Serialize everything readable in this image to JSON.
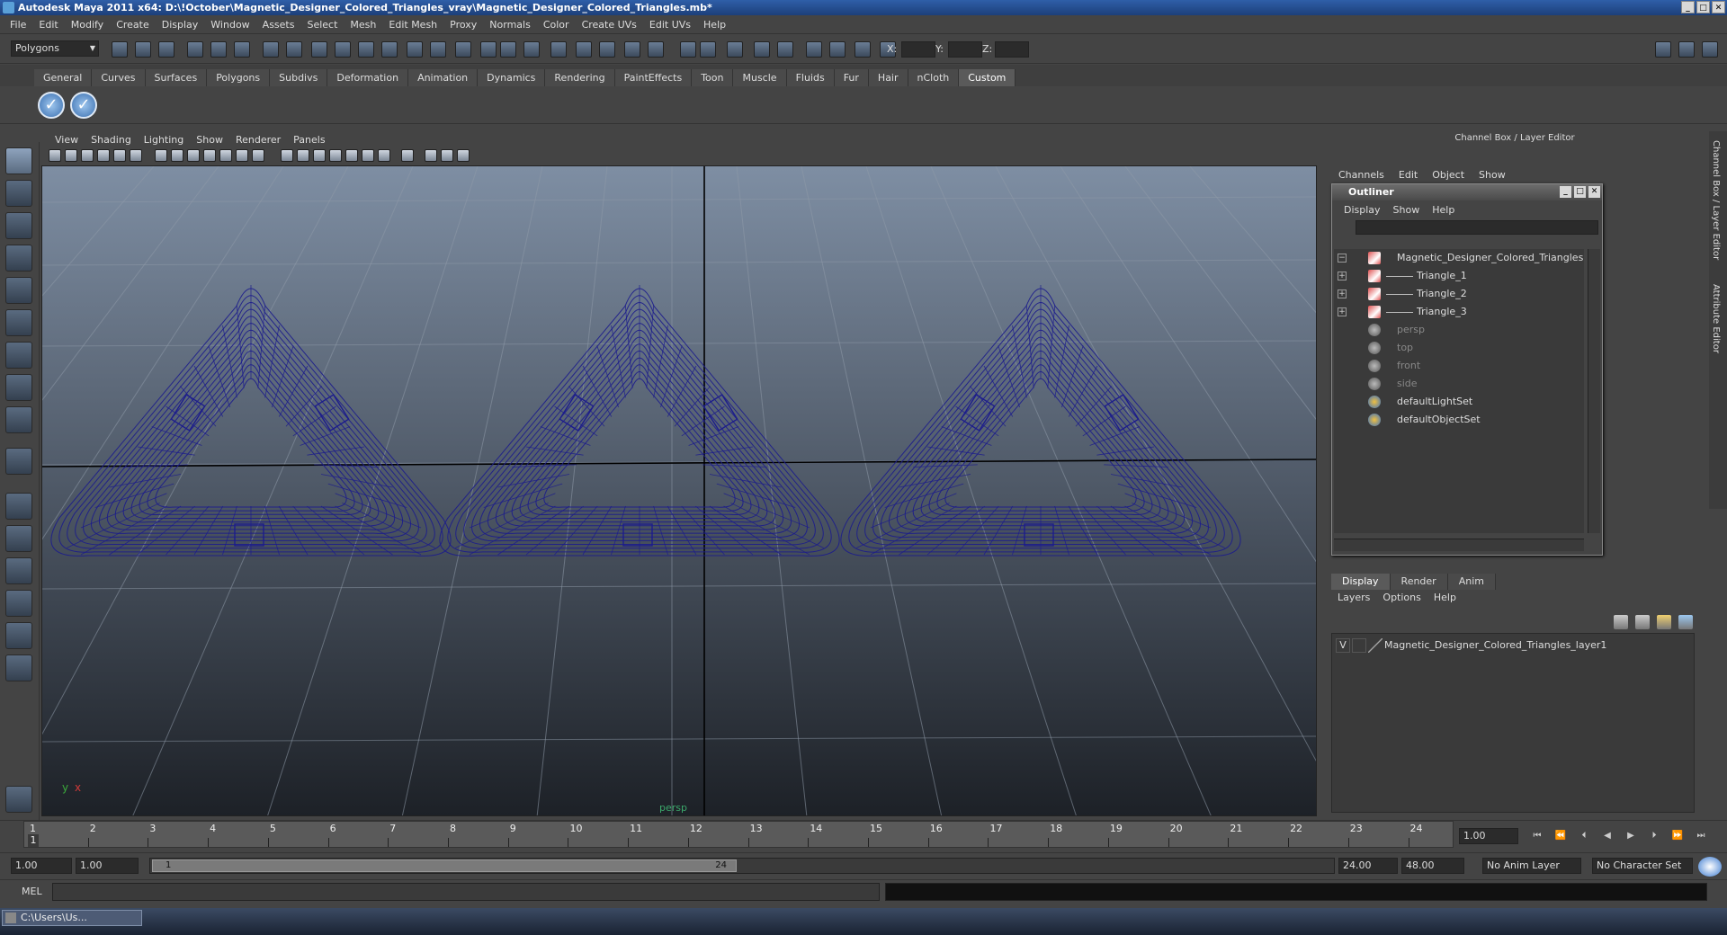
{
  "window": {
    "title": "Autodesk Maya 2011 x64: D:\\!October\\Magnetic_Designer_Colored_Triangles_vray\\Magnetic_Designer_Colored_Triangles.mb*"
  },
  "menubar": [
    "File",
    "Edit",
    "Modify",
    "Create",
    "Display",
    "Window",
    "Assets",
    "Select",
    "Mesh",
    "Edit Mesh",
    "Proxy",
    "Normals",
    "Color",
    "Create UVs",
    "Edit UVs",
    "Help"
  ],
  "status": {
    "mode": "Polygons",
    "x_label": "X:",
    "y_label": "Y:",
    "z_label": "Z:"
  },
  "shelf_tabs": [
    "General",
    "Curves",
    "Surfaces",
    "Polygons",
    "Subdivs",
    "Deformation",
    "Animation",
    "Dynamics",
    "Rendering",
    "PaintEffects",
    "Toon",
    "Muscle",
    "Fluids",
    "Fur",
    "Hair",
    "nCloth",
    "Custom"
  ],
  "shelf_active": "Custom",
  "viewport": {
    "menu": [
      "View",
      "Shading",
      "Lighting",
      "Show",
      "Renderer",
      "Panels"
    ],
    "camera": "persp",
    "axis_y": "y",
    "axis_x": "x",
    "wire_color": "#1c1c8c"
  },
  "channel_box": {
    "title": "Channel Box / Layer Editor",
    "menu": [
      "Channels",
      "Edit",
      "Object",
      "Show"
    ]
  },
  "outliner": {
    "title": "Outliner",
    "menu": [
      "Display",
      "Show",
      "Help"
    ],
    "items": [
      {
        "label": "Magnetic_Designer_Colored_Triangles",
        "icon": "mesh",
        "dim": false
      },
      {
        "label": "Triangle_1",
        "icon": "mesh",
        "dim": false
      },
      {
        "label": "Triangle_2",
        "icon": "mesh",
        "dim": false
      },
      {
        "label": "Triangle_3",
        "icon": "mesh",
        "dim": false
      },
      {
        "label": "persp",
        "icon": "cam",
        "dim": true
      },
      {
        "label": "top",
        "icon": "cam",
        "dim": true
      },
      {
        "label": "front",
        "icon": "cam",
        "dim": true
      },
      {
        "label": "side",
        "icon": "cam",
        "dim": true
      },
      {
        "label": "defaultLightSet",
        "icon": "set",
        "dim": false
      },
      {
        "label": "defaultObjectSet",
        "icon": "set",
        "dim": false
      }
    ]
  },
  "layers": {
    "tabs": [
      "Display",
      "Render",
      "Anim"
    ],
    "menu": [
      "Layers",
      "Options",
      "Help"
    ],
    "visible_flag": "V",
    "items": [
      "Magnetic_Designer_Colored_Triangles_layer1"
    ]
  },
  "side_tabs": [
    "Channel Box / Layer Editor",
    "Attribute Editor"
  ],
  "timeline": {
    "ticks": [
      1,
      2,
      3,
      4,
      5,
      6,
      7,
      8,
      9,
      10,
      11,
      12,
      13,
      14,
      15,
      16,
      17,
      18,
      19,
      20,
      21,
      22,
      23,
      24
    ],
    "current_marker": "1",
    "current_frame": "1.00"
  },
  "range": {
    "start": "1.00",
    "playback_start": "1.00",
    "slider_start": "1",
    "slider_end": "24",
    "playback_end": "24.00",
    "end": "48.00",
    "anim_layer": "No Anim Layer",
    "character_set": "No Character Set"
  },
  "command": {
    "label": "MEL"
  },
  "taskbar": {
    "item": "C:\\Users\\Us..."
  }
}
